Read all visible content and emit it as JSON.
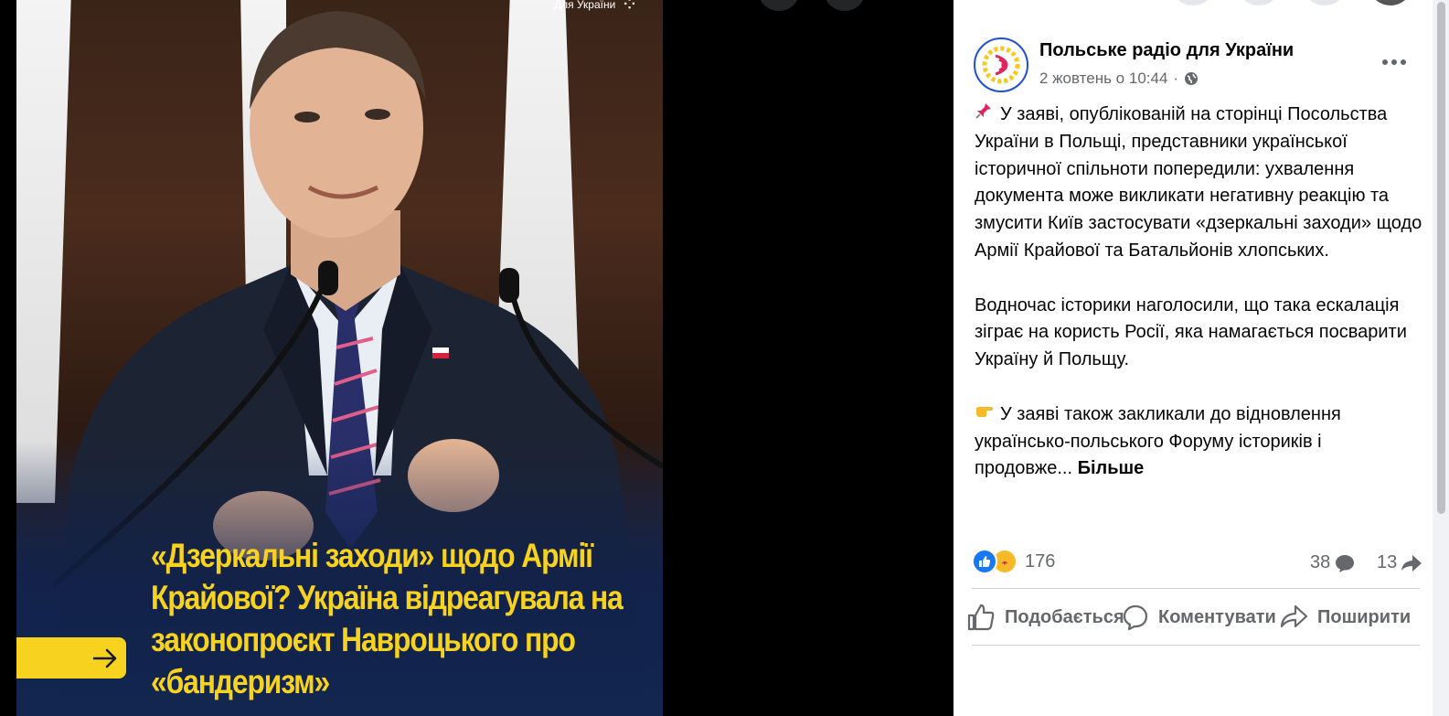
{
  "media": {
    "brand_mark": "Для України",
    "headline": "«Дзеркальні заходи» щодо Армії Крайової? Україна відреагувала на законопроєкт Навроцького про «бандеризм»",
    "headline_color": "#f7d21e",
    "arrow_icon": "arrow-right-icon"
  },
  "post": {
    "page_name": "Польське радіо для України",
    "date": "2 жовтень о 10:44",
    "separator": "·",
    "privacy_icon": "globe-icon",
    "paragraphs": [
      "У заяві, опублікованій на сторінці Посольства України в Польщі, представники української історичної спільноти попередили: ухвалення документа може викликати негативну реакцію та змусити Київ застосувати «дзеркальні заходи» щодо Армії Крайової та Батальйонів хлопських.",
      "Водночас історики наголосили, що така ескалація зіграє на користь Росії, яка намагається посварити Україну й Польщу.",
      "У заяві також закликали до відновлення українсько-польського Форуму істориків і продовже..."
    ],
    "paragraph_icons": [
      "pushpin-icon",
      "",
      "pointing-hand-icon"
    ],
    "more_label": "Більше",
    "reactions_count": "176",
    "comments_count": "38",
    "shares_count": "13",
    "actions": {
      "like": "Подобається",
      "comment": "Коментувати",
      "share": "Поширити"
    }
  },
  "colors": {
    "accent": "#1877f2",
    "care": "#f7b928",
    "secondary_text": "#65676b"
  }
}
